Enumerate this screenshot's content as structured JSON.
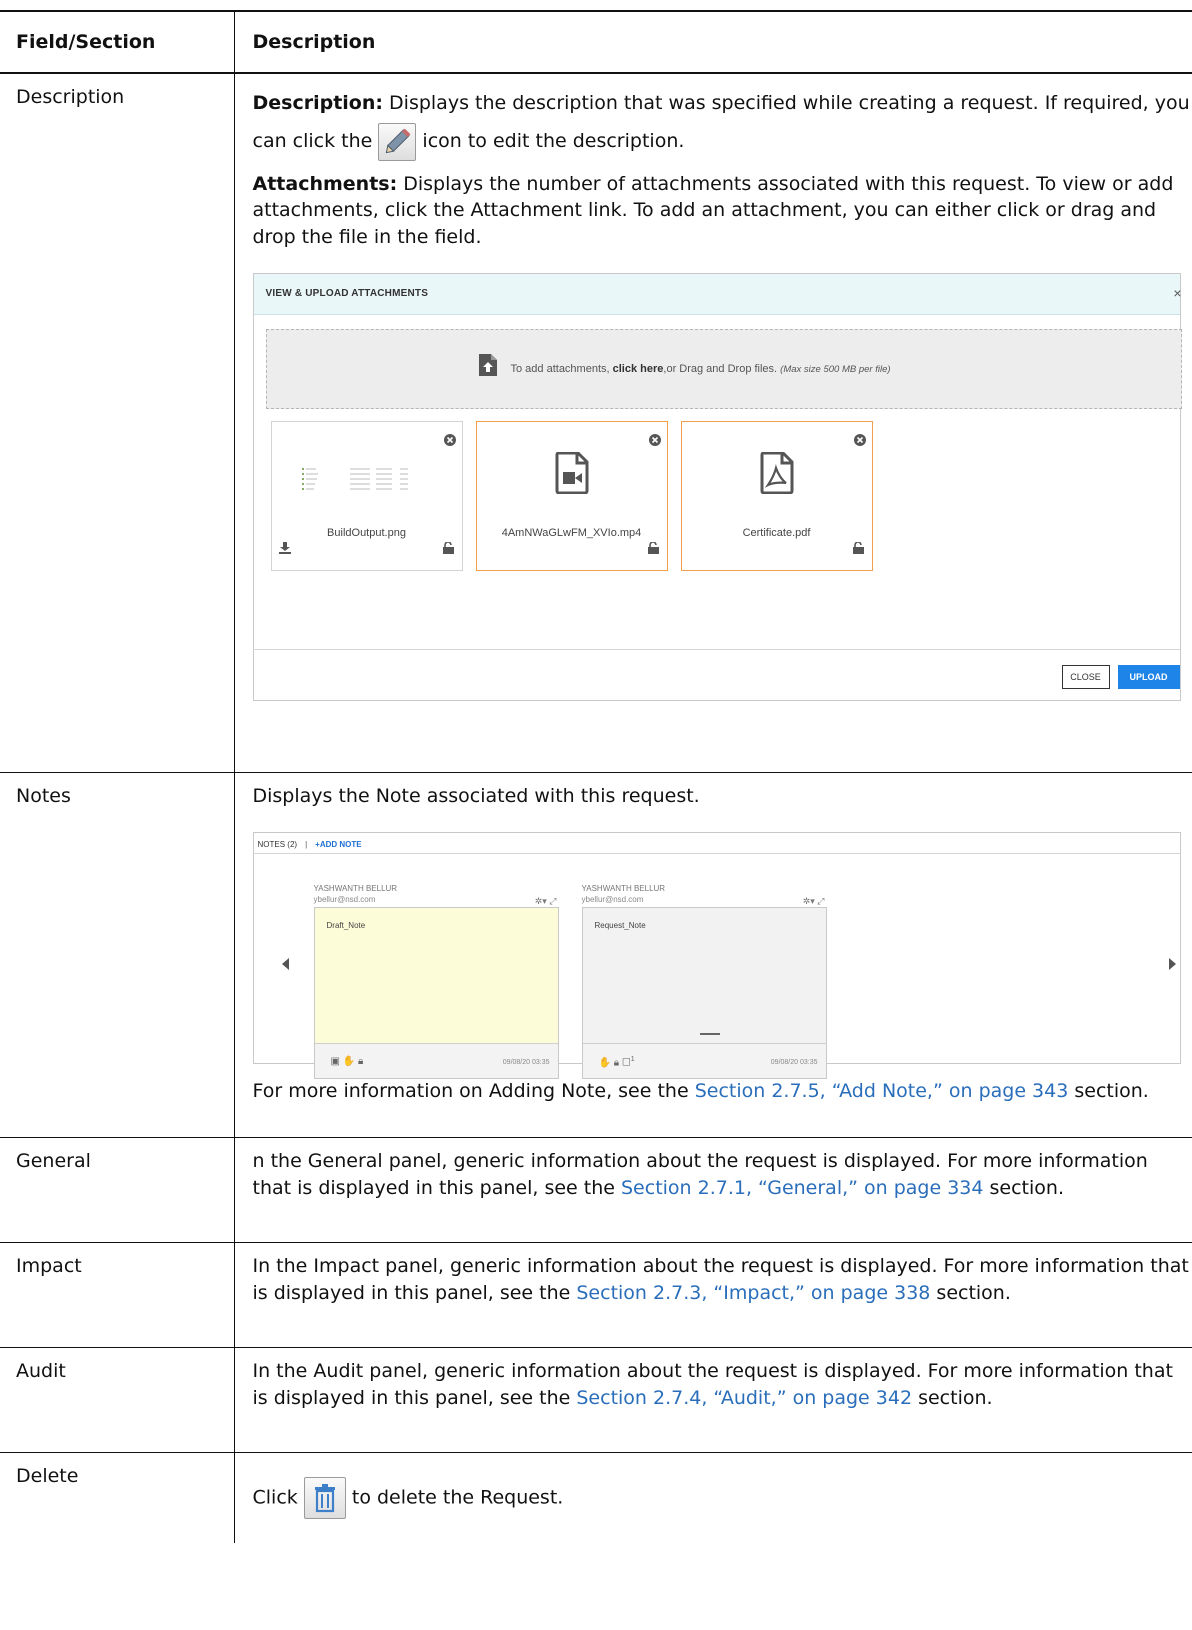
{
  "table": {
    "header": {
      "col1": "Field/Section",
      "col2": "Description"
    },
    "rows": {
      "description": {
        "field": "Description",
        "p1_label": "Description:",
        "p1_text_a": " Displays the description that was specified while creating a request. If required, you can click the ",
        "p1_text_b": " icon to edit the description.",
        "p2_label": "Attachments:",
        "p2_text": " Displays the number of attachments associated with this request. To view or add attachments, click the Attachment link. To add an attachment, you can either click or drag and drop the file in the field."
      },
      "notes": {
        "field": "Notes",
        "text": "Displays the Note associated with this request.",
        "more_a": "For more information on Adding Note, see the ",
        "more_link": "Section 2.7.5, “Add Note,” on page 343",
        "more_b": " section."
      },
      "general": {
        "field": "General",
        "text_a": "n the General panel, generic information about the request is displayed. For more information that is displayed in this panel, see the ",
        "link": "Section 2.7.1, “General,” on page 334",
        "text_b": " section."
      },
      "impact": {
        "field": "Impact",
        "text_a": "In the Impact panel, generic information about the request is displayed. For more information that is displayed in this panel, see the ",
        "link": "Section 2.7.3, “Impact,” on page 338",
        "text_b": " section."
      },
      "audit": {
        "field": "Audit",
        "text_a": "In the Audit panel, generic information about the request is displayed. For more information that is displayed in this panel, see the ",
        "link": "Section 2.7.4, “Audit,” on page 342",
        "text_b": " section."
      },
      "delete": {
        "field": "Delete",
        "text_a": "Click ",
        "text_b": " to delete the Request."
      }
    }
  },
  "attachments_dialog": {
    "title": "VIEW & UPLOAD ATTACHMENTS",
    "close_x": "×",
    "drop_text_a": "To add attachments, ",
    "drop_text_bold": "click here",
    "drop_text_b": ",or Drag and Drop files. ",
    "drop_text_italic": "(Max size 500 MB per file)",
    "files": [
      {
        "name": "BuildOutput.png",
        "kind": "image"
      },
      {
        "name": "4AmNWaGLwFM_XVIo.mp4",
        "kind": "video"
      },
      {
        "name": "Certificate.pdf",
        "kind": "pdf"
      }
    ],
    "close_button": "CLOSE",
    "upload_button": "UPLOAD"
  },
  "notes_panel": {
    "title": "NOTES (2)",
    "separator": "|",
    "add_note": "+ADD NOTE",
    "notes": [
      {
        "author": "YASHWANTH BELLUR",
        "email": "ybellur@nsd.com",
        "text": "Draft_Note",
        "date": "09/08/20 03:35",
        "color": "#fdfcd8"
      },
      {
        "author": "YASHWANTH BELLUR",
        "email": "ybellur@nsd.com",
        "text": "Request_Note",
        "date": "09/08/20 03:35",
        "color": "#f2f2f2"
      }
    ],
    "comment_count": "1"
  },
  "colors": {
    "link": "#2a6ebb",
    "upload_button": "#1f84e8",
    "selected_border": "#f0a050"
  }
}
